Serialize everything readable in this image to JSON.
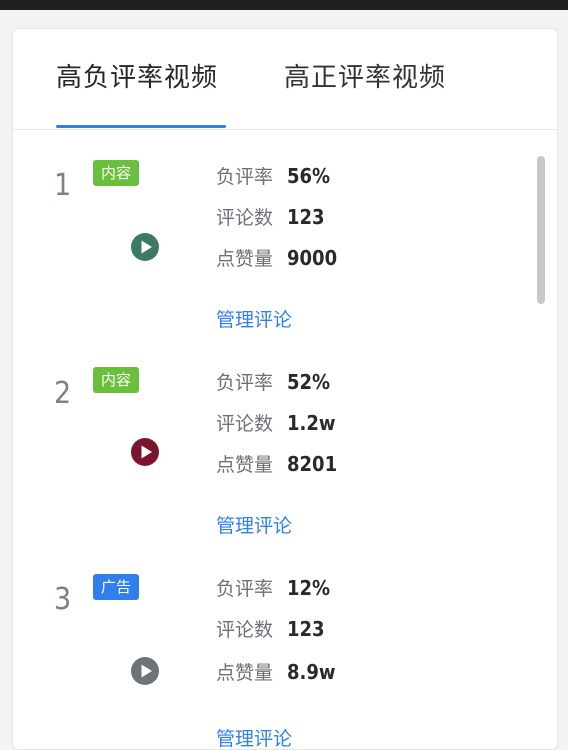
{
  "tabs": [
    {
      "label": "高负评率视频",
      "active": true
    },
    {
      "label": "高正评率视频",
      "active": false
    }
  ],
  "colors": {
    "accent": "#2f80ed",
    "badge_content": "#6abf3d",
    "badge_ad": "#2f80ed"
  },
  "items": [
    {
      "rank": "1",
      "badge": "内容",
      "badge_type": "content",
      "play_icon": "play-circle-icon",
      "play_color": "#3d7a63",
      "stats": [
        {
          "label": "负评率",
          "value": "56%"
        },
        {
          "label": "评论数",
          "value": "123"
        },
        {
          "label": "点赞量",
          "value": "9000"
        }
      ],
      "manage_label": "管理评论"
    },
    {
      "rank": "2",
      "badge": "内容",
      "badge_type": "content",
      "play_icon": "play-circle-icon",
      "play_color": "#7a1530",
      "stats": [
        {
          "label": "负评率",
          "value": "52%"
        },
        {
          "label": "评论数",
          "value": "1.2w"
        },
        {
          "label": "点赞量",
          "value": "8201"
        }
      ],
      "manage_label": "管理评论"
    },
    {
      "rank": "3",
      "badge": "广告",
      "badge_type": "ad",
      "play_icon": "play-circle-icon",
      "play_color": "#6e737b",
      "stats": [
        {
          "label": "负评率",
          "value": "12%"
        },
        {
          "label": "评论数",
          "value": "123"
        },
        {
          "label": "点赞量",
          "value": "8.9w"
        }
      ],
      "manage_label": "管理评论"
    }
  ]
}
